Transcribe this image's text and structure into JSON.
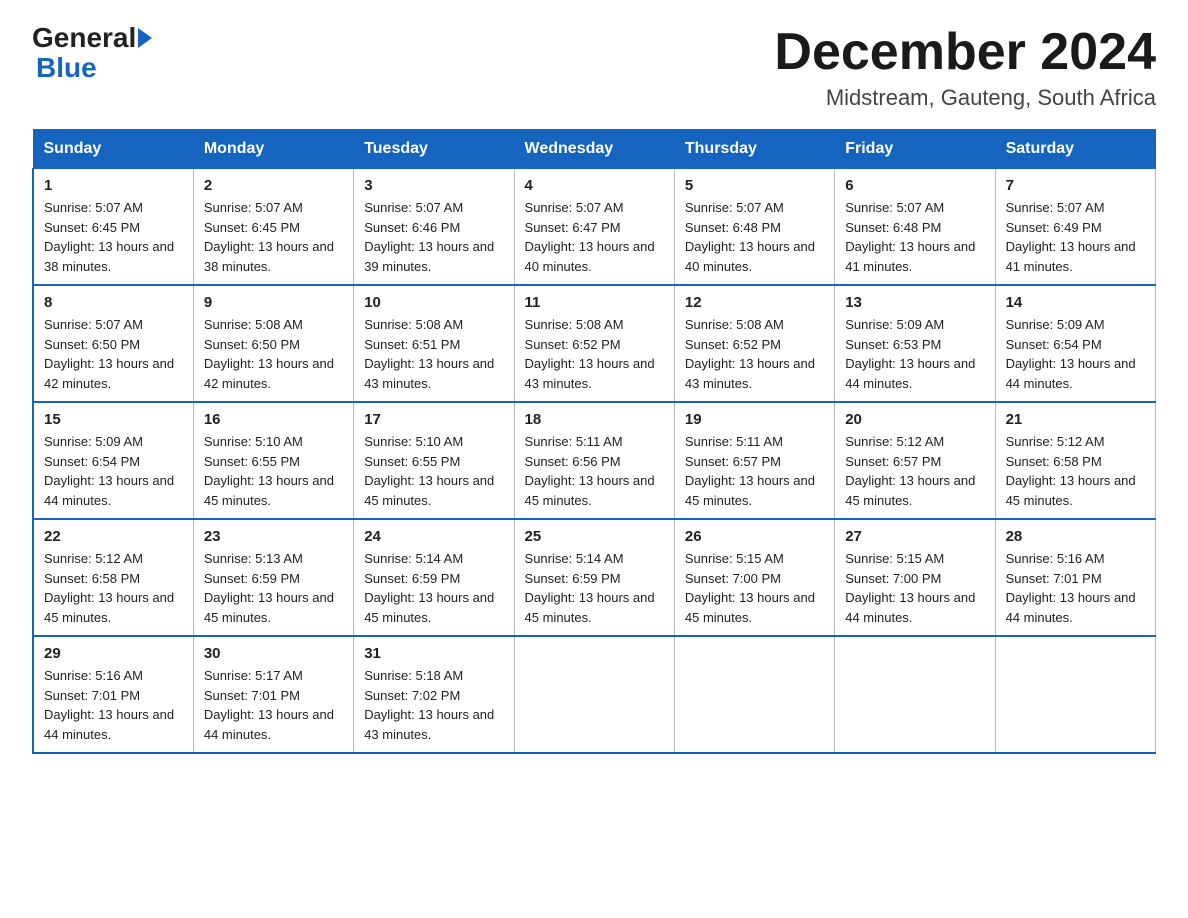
{
  "logo": {
    "general": "General",
    "blue": "Blue"
  },
  "title": "December 2024",
  "subtitle": "Midstream, Gauteng, South Africa",
  "days": [
    "Sunday",
    "Monday",
    "Tuesday",
    "Wednesday",
    "Thursday",
    "Friday",
    "Saturday"
  ],
  "weeks": [
    [
      {
        "num": "1",
        "sunrise": "5:07 AM",
        "sunset": "6:45 PM",
        "daylight": "13 hours and 38 minutes."
      },
      {
        "num": "2",
        "sunrise": "5:07 AM",
        "sunset": "6:45 PM",
        "daylight": "13 hours and 38 minutes."
      },
      {
        "num": "3",
        "sunrise": "5:07 AM",
        "sunset": "6:46 PM",
        "daylight": "13 hours and 39 minutes."
      },
      {
        "num": "4",
        "sunrise": "5:07 AM",
        "sunset": "6:47 PM",
        "daylight": "13 hours and 40 minutes."
      },
      {
        "num": "5",
        "sunrise": "5:07 AM",
        "sunset": "6:48 PM",
        "daylight": "13 hours and 40 minutes."
      },
      {
        "num": "6",
        "sunrise": "5:07 AM",
        "sunset": "6:48 PM",
        "daylight": "13 hours and 41 minutes."
      },
      {
        "num": "7",
        "sunrise": "5:07 AM",
        "sunset": "6:49 PM",
        "daylight": "13 hours and 41 minutes."
      }
    ],
    [
      {
        "num": "8",
        "sunrise": "5:07 AM",
        "sunset": "6:50 PM",
        "daylight": "13 hours and 42 minutes."
      },
      {
        "num": "9",
        "sunrise": "5:08 AM",
        "sunset": "6:50 PM",
        "daylight": "13 hours and 42 minutes."
      },
      {
        "num": "10",
        "sunrise": "5:08 AM",
        "sunset": "6:51 PM",
        "daylight": "13 hours and 43 minutes."
      },
      {
        "num": "11",
        "sunrise": "5:08 AM",
        "sunset": "6:52 PM",
        "daylight": "13 hours and 43 minutes."
      },
      {
        "num": "12",
        "sunrise": "5:08 AM",
        "sunset": "6:52 PM",
        "daylight": "13 hours and 43 minutes."
      },
      {
        "num": "13",
        "sunrise": "5:09 AM",
        "sunset": "6:53 PM",
        "daylight": "13 hours and 44 minutes."
      },
      {
        "num": "14",
        "sunrise": "5:09 AM",
        "sunset": "6:54 PM",
        "daylight": "13 hours and 44 minutes."
      }
    ],
    [
      {
        "num": "15",
        "sunrise": "5:09 AM",
        "sunset": "6:54 PM",
        "daylight": "13 hours and 44 minutes."
      },
      {
        "num": "16",
        "sunrise": "5:10 AM",
        "sunset": "6:55 PM",
        "daylight": "13 hours and 45 minutes."
      },
      {
        "num": "17",
        "sunrise": "5:10 AM",
        "sunset": "6:55 PM",
        "daylight": "13 hours and 45 minutes."
      },
      {
        "num": "18",
        "sunrise": "5:11 AM",
        "sunset": "6:56 PM",
        "daylight": "13 hours and 45 minutes."
      },
      {
        "num": "19",
        "sunrise": "5:11 AM",
        "sunset": "6:57 PM",
        "daylight": "13 hours and 45 minutes."
      },
      {
        "num": "20",
        "sunrise": "5:12 AM",
        "sunset": "6:57 PM",
        "daylight": "13 hours and 45 minutes."
      },
      {
        "num": "21",
        "sunrise": "5:12 AM",
        "sunset": "6:58 PM",
        "daylight": "13 hours and 45 minutes."
      }
    ],
    [
      {
        "num": "22",
        "sunrise": "5:12 AM",
        "sunset": "6:58 PM",
        "daylight": "13 hours and 45 minutes."
      },
      {
        "num": "23",
        "sunrise": "5:13 AM",
        "sunset": "6:59 PM",
        "daylight": "13 hours and 45 minutes."
      },
      {
        "num": "24",
        "sunrise": "5:14 AM",
        "sunset": "6:59 PM",
        "daylight": "13 hours and 45 minutes."
      },
      {
        "num": "25",
        "sunrise": "5:14 AM",
        "sunset": "6:59 PM",
        "daylight": "13 hours and 45 minutes."
      },
      {
        "num": "26",
        "sunrise": "5:15 AM",
        "sunset": "7:00 PM",
        "daylight": "13 hours and 45 minutes."
      },
      {
        "num": "27",
        "sunrise": "5:15 AM",
        "sunset": "7:00 PM",
        "daylight": "13 hours and 44 minutes."
      },
      {
        "num": "28",
        "sunrise": "5:16 AM",
        "sunset": "7:01 PM",
        "daylight": "13 hours and 44 minutes."
      }
    ],
    [
      {
        "num": "29",
        "sunrise": "5:16 AM",
        "sunset": "7:01 PM",
        "daylight": "13 hours and 44 minutes."
      },
      {
        "num": "30",
        "sunrise": "5:17 AM",
        "sunset": "7:01 PM",
        "daylight": "13 hours and 44 minutes."
      },
      {
        "num": "31",
        "sunrise": "5:18 AM",
        "sunset": "7:02 PM",
        "daylight": "13 hours and 43 minutes."
      },
      null,
      null,
      null,
      null
    ]
  ]
}
